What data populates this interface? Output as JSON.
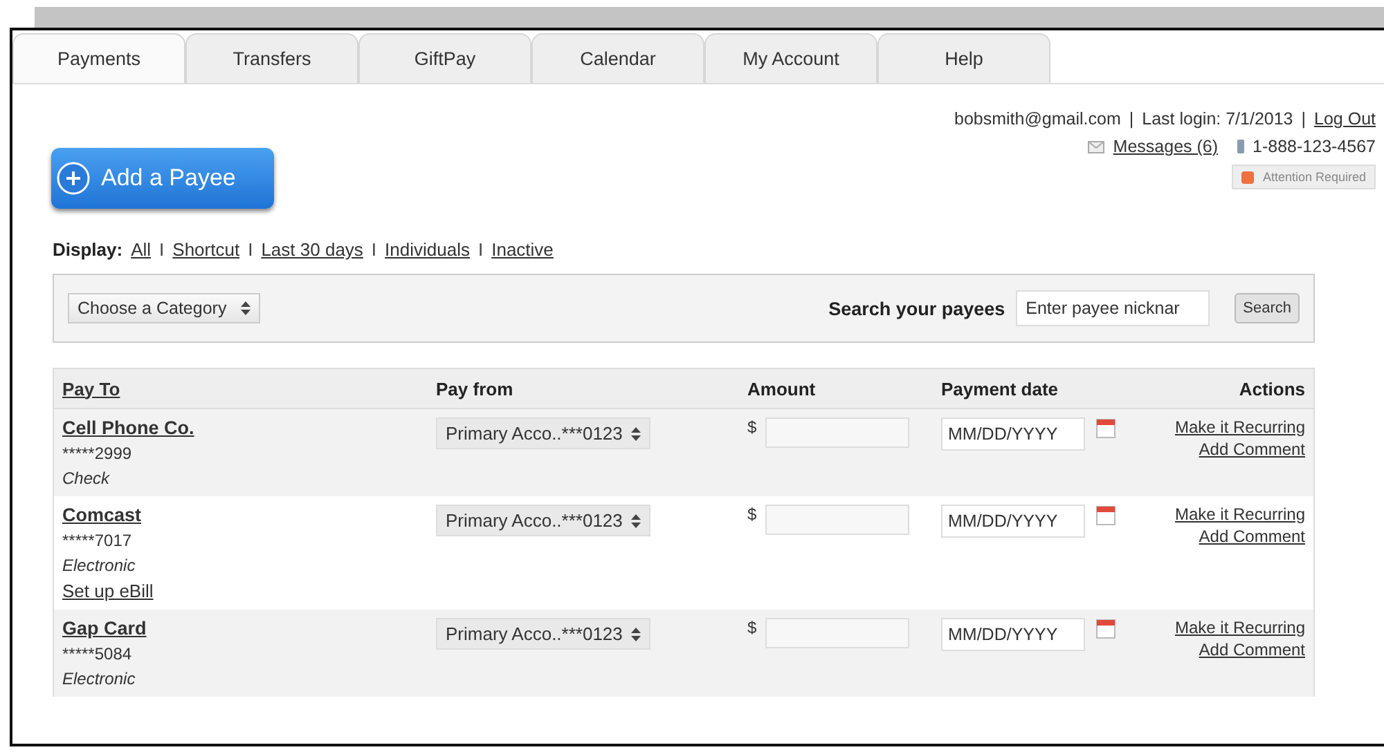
{
  "tabs": [
    {
      "label": "Payments",
      "selected": true
    },
    {
      "label": "Transfers",
      "selected": false
    },
    {
      "label": "GiftPay",
      "selected": false
    },
    {
      "label": "Calendar",
      "selected": false
    },
    {
      "label": "My Account",
      "selected": false
    },
    {
      "label": "Help",
      "selected": false
    }
  ],
  "add_button": {
    "label": "Add a Payee"
  },
  "account": {
    "email": "bobsmith@gmail.com",
    "separator_1": "|",
    "last_login": "Last login: 7/1/2013",
    "separator_2": "|",
    "logout": "Log Out",
    "messages": "Messages (6)",
    "phone": "1-888-123-4567",
    "alert": "Attention Required"
  },
  "display_filter": {
    "label": "Display:",
    "options": [
      {
        "label": "All",
        "selected": false
      },
      {
        "separator": "I",
        "label": "Shortcut",
        "selected": false
      },
      {
        "separator": "I",
        "label": "Last 30 days",
        "selected": false
      },
      {
        "separator": "I",
        "label": "Individuals",
        "selected": false
      },
      {
        "separator": "I",
        "label": "Inactive",
        "selected": false
      }
    ]
  },
  "filter_bar": {
    "category": "Choose a Category",
    "search_label": "Search your payees",
    "search_placeholder": "Enter payee nicknar",
    "search_button": "Search"
  },
  "table": {
    "columns": [
      "Pay To",
      "Pay from",
      "Amount",
      "Payment date",
      "Actions"
    ],
    "rows": [
      {
        "name": "Cell Phone Co.",
        "number": "*****2999",
        "method": "Check",
        "pay_from": "Primary Acco..***0123",
        "currency": "$",
        "date_placeholder": "MM/DD/YYYY",
        "actions": [
          "Make it Recurring",
          "Add Comment"
        ]
      },
      {
        "name": "Comcast",
        "number": "*****7017",
        "method": "Electronic",
        "ebill": "Set up eBill",
        "pay_from": "Primary Acco..***0123",
        "currency": "$",
        "date_placeholder": "MM/DD/YYYY",
        "actions": [
          "Make it Recurring",
          "Add Comment"
        ]
      },
      {
        "name": "Gap Card",
        "number": "*****5084",
        "method": "Electronic",
        "pay_from": "Primary Acco..***0123",
        "currency": "$",
        "date_placeholder": "MM/DD/YYYY",
        "actions": [
          "Make it Recurring",
          "Add Comment"
        ]
      }
    ]
  }
}
